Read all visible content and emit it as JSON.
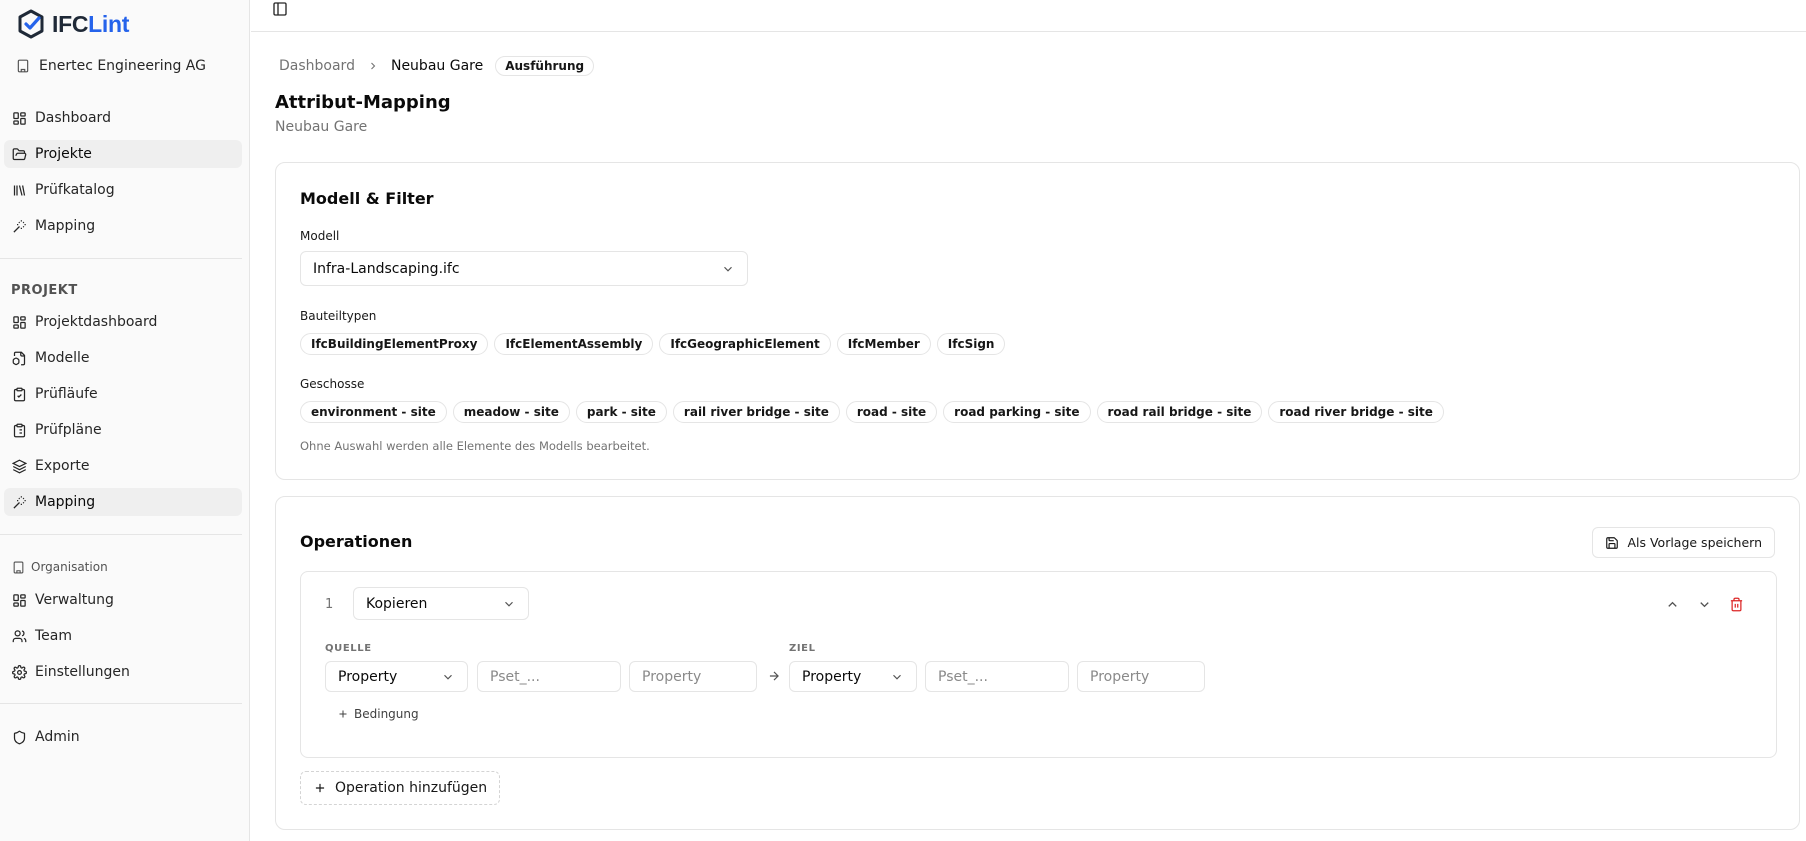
{
  "app": {
    "logo_ifc": "IFC",
    "logo_lint": "Lint",
    "organization": "Enertec Engineering AG"
  },
  "sidebar": {
    "main_items": [
      {
        "label": "Dashboard",
        "icon": "grid-icon"
      },
      {
        "label": "Projekte",
        "icon": "folder-open-icon",
        "active": true
      },
      {
        "label": "Prüfkatalog",
        "icon": "library-icon"
      },
      {
        "label": "Mapping",
        "icon": "wand-icon"
      }
    ],
    "project_section": "PROJEKT",
    "project_items": [
      {
        "label": "Projektdashboard",
        "icon": "grid-icon"
      },
      {
        "label": "Modelle",
        "icon": "file-box-icon"
      },
      {
        "label": "Prüfläufe",
        "icon": "clipboard-check-icon"
      },
      {
        "label": "Prüfpläne",
        "icon": "clipboard-list-icon"
      },
      {
        "label": "Exporte",
        "icon": "layers-icon"
      },
      {
        "label": "Mapping",
        "icon": "wand-icon",
        "active": true
      }
    ],
    "org_section": "Organisation",
    "org_items": [
      {
        "label": "Verwaltung",
        "icon": "grid-icon"
      },
      {
        "label": "Team",
        "icon": "users-icon"
      },
      {
        "label": "Einstellungen",
        "icon": "gear-icon"
      }
    ],
    "admin_item": {
      "label": "Admin",
      "icon": "shield-icon"
    }
  },
  "breadcrumb": {
    "root": "Dashboard",
    "current": "Neubau Gare",
    "status": "Ausführung"
  },
  "page": {
    "title": "Attribut-Mapping",
    "subtitle": "Neubau Gare"
  },
  "filter_card": {
    "title": "Modell & Filter",
    "model_label": "Modell",
    "model_value": "Infra-Landscaping.ifc",
    "types_label": "Bauteiltypen",
    "types": [
      "IfcBuildingElementProxy",
      "IfcElementAssembly",
      "IfcGeographicElement",
      "IfcMember",
      "IfcSign"
    ],
    "storeys_label": "Geschosse",
    "storeys": [
      "environment - site",
      "meadow - site",
      "park - site",
      "rail river bridge - site",
      "road - site",
      "road parking - site",
      "road rail bridge - site",
      "road river bridge - site"
    ],
    "hint": "Ohne Auswahl werden alle Elemente des Modells bearbeitet."
  },
  "operations_card": {
    "title": "Operationen",
    "save_template": "Als Vorlage speichern",
    "operation": {
      "number": "1",
      "type": "Kopieren",
      "source_label": "QUELLE",
      "target_label": "ZIEL",
      "source_kind": "Property",
      "source_pset_placeholder": "Pset_...",
      "source_property_placeholder": "Property",
      "target_kind": "Property",
      "target_pset_placeholder": "Pset_...",
      "target_property_placeholder": "Property",
      "condition_label": "Bedingung"
    },
    "add_operation": "Operation hinzufügen"
  },
  "colors": {
    "brand": "#2563eb",
    "delete": "#dc2626",
    "sidebar_bg": "#fafafa",
    "border": "#e5e5e5"
  }
}
